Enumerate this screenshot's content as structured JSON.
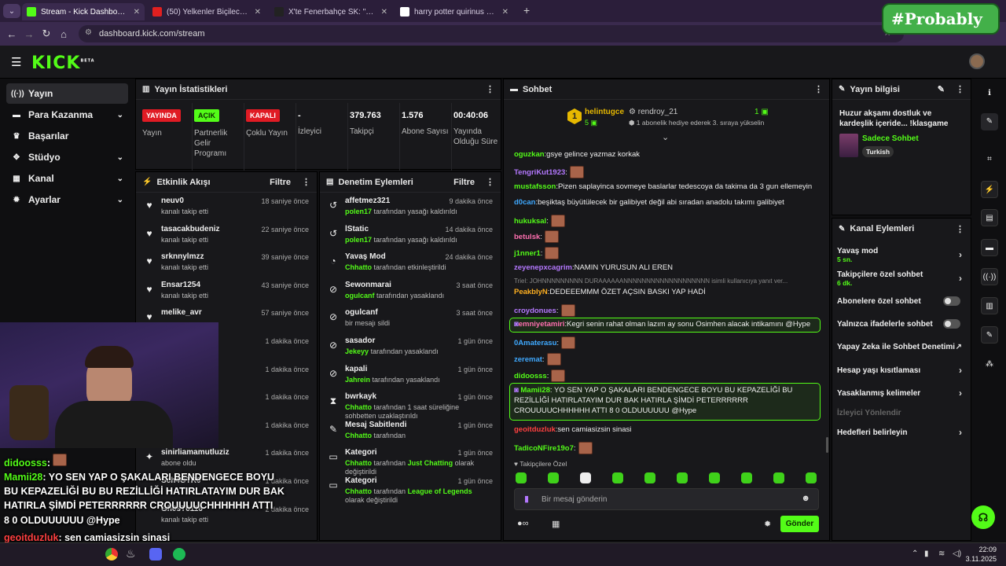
{
  "browser": {
    "tabs": [
      {
        "title": "Stream - Kick Dashboard",
        "fav": "#53fc18",
        "active": true
      },
      {
        "title": "(50) Yelkenler Biçilecek (Psytran",
        "fav": "#e02020",
        "active": false
      },
      {
        "title": "X'te Fenerbahçe SK: \"Siz bunun",
        "fav": "#222222",
        "active": false
      },
      {
        "title": "harry potter quirinus quirrell - G",
        "fav": "#ffffff",
        "active": false
      }
    ],
    "url": "dashboard.kick.com/stream"
  },
  "overlay_brand": "#Probably",
  "kick": {
    "logo": "KICK",
    "logo_sup": "BETA"
  },
  "sidebar": {
    "items": [
      {
        "label": "Yayın",
        "icon": "stream-icon",
        "glyph": "((·))",
        "selected": true,
        "chevron": false
      },
      {
        "label": "Para Kazanma",
        "icon": "money-icon",
        "glyph": "▬",
        "selected": false,
        "chevron": true
      },
      {
        "label": "Başarılar",
        "icon": "trophy-icon",
        "glyph": "♛",
        "selected": false,
        "chevron": false
      },
      {
        "label": "Stüdyo",
        "icon": "palette-icon",
        "glyph": "✥",
        "selected": false,
        "chevron": true
      },
      {
        "label": "Kanal",
        "icon": "grid-icon",
        "glyph": "▦",
        "selected": false,
        "chevron": true
      },
      {
        "label": "Ayarlar",
        "icon": "gear-icon",
        "glyph": "✹",
        "selected": false,
        "chevron": true
      }
    ]
  },
  "stats": {
    "title": "Yayın İstatistikleri",
    "cols": [
      {
        "badge": "YAYINDA",
        "badge_bg": "#e01b24",
        "badge_fg": "#ffffff",
        "label": "Yayın"
      },
      {
        "badge": "AÇIK",
        "badge_bg": "#53fc18",
        "badge_fg": "#0b2d00",
        "label": "Partnerlik Gelir Programı"
      },
      {
        "badge": "KAPALI",
        "badge_bg": "#e01b24",
        "badge_fg": "#ffffff",
        "label": "Çoklu Yayın"
      },
      {
        "value": "-",
        "label": "İzleyici"
      },
      {
        "value": "379.763",
        "label": "Takipçi"
      },
      {
        "value": "1.576",
        "label": "Abone Sayısı"
      },
      {
        "value": "00:40:06",
        "label": "Yayında Olduğu Süre"
      }
    ]
  },
  "activity": {
    "title": "Etkinlik Akışı",
    "filter": "Filtre",
    "items": [
      {
        "name": "neuv0",
        "sub": "kanalı takip etti",
        "time": "18 saniye önce",
        "icon": "♥"
      },
      {
        "name": "tasacakbudeniz",
        "sub": "kanalı takip etti",
        "time": "22 saniye önce",
        "icon": "♥"
      },
      {
        "name": "srknnylmzz",
        "sub": "kanalı takip etti",
        "time": "39 saniye önce",
        "icon": "♥"
      },
      {
        "name": "Ensar1254",
        "sub": "kanalı takip etti",
        "time": "43 saniye önce",
        "icon": "♥"
      },
      {
        "name": "melike_avr",
        "sub": "",
        "time": "57 saniye önce",
        "icon": "♥"
      },
      {
        "name": "",
        "sub": "",
        "time": "1 dakika önce",
        "icon": ""
      },
      {
        "name": "",
        "sub": "",
        "time": "1 dakika önce",
        "icon": ""
      },
      {
        "name": "",
        "sub": "",
        "time": "1 dakika önce",
        "icon": ""
      },
      {
        "name": "",
        "sub": "",
        "time": "1 dakika önce",
        "icon": ""
      },
      {
        "name": "sinirliamamutluziz",
        "sub": "abone oldu",
        "time": "1 dakika önce",
        "icon": "✦"
      },
      {
        "name": "Sch4GTR0",
        "sub": "",
        "time": "1 dakika önce",
        "icon": ""
      },
      {
        "name": "Gh0sT6116",
        "sub": "kanalı takip etti",
        "time": "2 dakika önce",
        "icon": ""
      }
    ]
  },
  "moderation": {
    "title": "Denetim Eylemleri",
    "filter": "Filtre",
    "items": [
      {
        "name": "affetmez321",
        "actor": "polen17",
        "rest": "tarafından yasağı kaldırıldı",
        "time": "9 dakika önce",
        "icon": "↺"
      },
      {
        "name": "lStatic",
        "actor": "polen17",
        "rest": "tarafından yasağı kaldırıldı",
        "time": "14 dakika önce",
        "icon": "↺"
      },
      {
        "name": "Yavaş Mod",
        "actor": "Chhatto",
        "rest": "tarafından etkinleştirildi",
        "time": "24 dakika önce",
        "icon": "◔"
      },
      {
        "name": "Sewonmarai",
        "actor": "ogulcanf",
        "rest": "tarafından yasaklandı",
        "time": "3 saat önce",
        "icon": "⊘"
      },
      {
        "name": "ogulcanf",
        "actor": "",
        "rest": "bir mesajı sildi",
        "time": "3 saat önce",
        "icon": "⊘"
      },
      {
        "name": "sasador",
        "actor": "Jekeyy",
        "rest": "tarafından yasaklandı",
        "time": "1 gün önce",
        "icon": "⊘"
      },
      {
        "name": "kapali",
        "actor": "Jahrein",
        "rest": "tarafından yasaklandı",
        "time": "1 gün önce",
        "icon": "⊘"
      },
      {
        "name": "bwrkayk",
        "actor": "Chhatto",
        "rest": "tarafından 1 saat süreliğine sohbetten uzaklaştırıldı",
        "time": "1 gün önce",
        "icon": "⧗"
      },
      {
        "name": "Mesaj Sabitlendi",
        "actor": "Chhatto",
        "rest": "tarafından",
        "time": "1 gün önce",
        "icon": "✎"
      },
      {
        "name": "Kategori",
        "actor": "Chhatto",
        "rest": "tarafından",
        "extra": "Just Chatting",
        "rest2": "olarak değiştirildi",
        "time": "1 gün önce",
        "icon": "▭"
      },
      {
        "name": "Kategori",
        "actor": "Chhatto",
        "rest": "tarafından",
        "extra": "League of Legends",
        "rest2": "olarak değiştirildi",
        "time": "1 gün önce",
        "icon": "▭"
      }
    ]
  },
  "chat": {
    "title": "Sohbet",
    "pinned": {
      "rank": "1",
      "user": "helintugce",
      "count": "5",
      "gifter": "rendroy_21",
      "gift_count": "1",
      "note": "1 abonelik hediye ederek 3. sıraya yükselin"
    },
    "messages": [
      {
        "user": "oguzkan",
        "color": "#53fc18",
        "text": "gsye gelince yazmaz korkak",
        "emote": false
      },
      {
        "user": "TengriKut1923",
        "color": "#b478ff",
        "text": "",
        "emote": true
      },
      {
        "user": "mustafsson",
        "color": "#53fc18",
        "text": "Pizen saplayinca sovmeye baslarlar tedescoya da takima da 3 gun ellemeyin",
        "emote": false
      },
      {
        "user": "d0can",
        "color": "#3fa9ff",
        "text": "beşiktaş büyütülecek bir galibiyet değil abi sıradan anadolu takımı galibiyet",
        "emote": false
      },
      {
        "user": "hukuksal",
        "color": "#53fc18",
        "text": "",
        "emote": true
      },
      {
        "user": "betulsk",
        "color": "#ff6fb0",
        "text": "",
        "emote": true
      },
      {
        "user": "j1nner1",
        "color": "#53fc18",
        "text": "",
        "emote": true
      },
      {
        "user": "zeyenepxcagrim",
        "color": "#b478ff",
        "text": "NAMIN YURUSUN ALI EREN",
        "emote": false
      },
      {
        "user": "PeakbIyN",
        "color": "#ffb020",
        "text": "DEDEEEMMM ÖZET AÇSIN BASKI YAP HADİ",
        "emote": false,
        "reply": "Triel: JOHNNNNNNNNN DURAAAAAANNNNNNNNNNNNNNNNNNN isimli kullanıcıya yanıt ver..."
      },
      {
        "user": "croydonues",
        "color": "#b478ff",
        "text": "",
        "emote": true
      },
      {
        "user": "emniyetamiri",
        "color": "#ff6fb0",
        "text": "Kegri senin rahat olman lazım ay sonu Osimhen alacak intikamını @Hype",
        "emote": false,
        "highlight": true
      },
      {
        "user": "0Amaterasu",
        "color": "#3fa9ff",
        "text": "",
        "emote": true
      },
      {
        "user": "zeremat",
        "color": "#3fa9ff",
        "text": "",
        "emote": true
      },
      {
        "user": "didoosss",
        "color": "#53fc18",
        "text": "",
        "emote": true
      },
      {
        "user": "Mamii28",
        "color": "#53fc18",
        "text": "YO SEN YAP O ŞAKALARI BENDENGECE BOYU BU KEPAZELİĞİ BU REZİLLİĞİ HATIRLATAYIM DUR BAK HATIRLA ŞİMDİ PETERRRRRR CROUUUUCHHHHHH ATTI 8 0 OLDUUUUUU @Hype",
        "emote": false,
        "highlight": true
      },
      {
        "user": "geoitduzluk",
        "color": "#ff4040",
        "text": "sen camiasizsin sinasi",
        "emote": false
      },
      {
        "user": "TadicoNFire19o7",
        "color": "#53fc18",
        "text": "",
        "emote": true
      }
    ],
    "followers_only": "Takipçilere Özel",
    "input_placeholder": "Bir mesaj gönderin",
    "send": "Gönder"
  },
  "stream_info": {
    "title": "Yayın bilgisi",
    "stream_title": "Huzur akşamı dostluk ve kardeşlik içeride... !klasgame",
    "category": "Sadece Sohbet",
    "language": "Turkish"
  },
  "channel_actions": {
    "title": "Kanal Eylemleri",
    "items": [
      {
        "label": "Yavaş mod",
        "sub": "5 sn.",
        "control": "chevron"
      },
      {
        "label": "Takipçilere özel sohbet",
        "sub": "6 dk.",
        "control": "chevron"
      },
      {
        "label": "Abonelere özel sohbet",
        "sub": "",
        "control": "toggle"
      },
      {
        "label": "Yalnızca ifadelerle sohbet",
        "sub": "",
        "control": "toggle"
      },
      {
        "label": "Yapay Zeka ile Sohbet Denetimi",
        "sub": "",
        "control": "external"
      },
      {
        "label": "Hesap yaşı kısıtlaması",
        "sub": "",
        "control": "chevron"
      },
      {
        "label": "Yasaklanmış kelimeler",
        "sub": "",
        "control": "chevron"
      },
      {
        "label": "İzleyici Yönlendir",
        "sub": "",
        "control": "none",
        "disabled": true
      },
      {
        "label": "Hedefleri belirleyin",
        "sub": "",
        "control": "chevron"
      }
    ]
  },
  "overlay_chat": [
    {
      "user": "didoosss",
      "color": "#53fc18",
      "text": ":"
    },
    {
      "user": "Mamii28",
      "color": "#53fc18",
      "text": ": YO SEN YAP O ŞAKALARI BENDENGECE BOYU"
    },
    {
      "user": "",
      "color": "#ffffff",
      "text": "BU REZİLLİĞİ HATIRLATAYIM DUR BAK"
    },
    {
      "user": "",
      "color": "#ffffff",
      "text": "HATIRLA ŞİMDİ PETERRRRRR CROUUUUCHHHHHH ATTI"
    },
    {
      "user": "",
      "color": "#ffffff",
      "text": "8 0 OLDUUUUUU @Hype"
    },
    {
      "user": "geoitduzluk",
      "color": "#ff4040",
      "text": ": sen camiasizsin sinasi"
    },
    {
      "user": "TadicoNFire19o7",
      "color": "#53fc18",
      "text": ""
    }
  ],
  "overlay_chat_line2_prefix": "BU KEPAZELİĞİ BU",
  "taskbar": {
    "time": "22:09",
    "date": "3.11.2025"
  }
}
